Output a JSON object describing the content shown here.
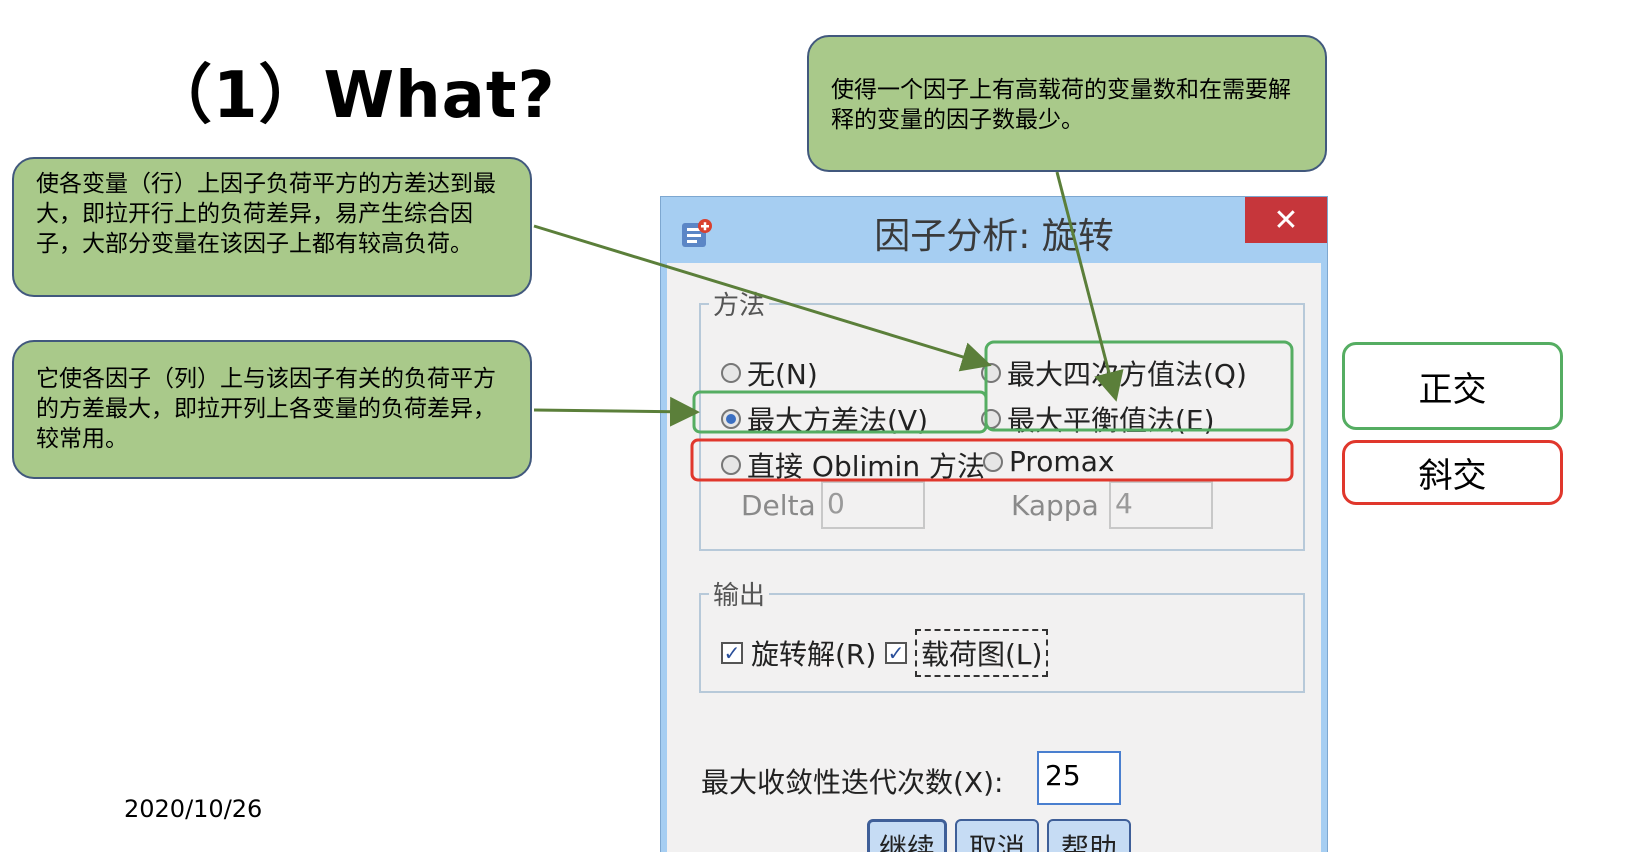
{
  "slide": {
    "title": "（1）What?",
    "date": "2020/10/26"
  },
  "callouts": {
    "variance_rows": "使各变量（行）上因子负荷平方的方差达到最大，即拉开行上的负荷差异，易产生综合因子，大部分变量在该因子上都有较高负荷。",
    "varimax": "它使各因子（列）上与该因子有关的负荷平方的方差最大，即拉开列上各变量的负荷差异，较常用。",
    "quartimax": "使得一个因子上有高载荷的变量数和在需要解释的变量的因子数最少。"
  },
  "labels": {
    "orthogonal": "正交",
    "oblique": "斜交"
  },
  "dialog": {
    "title": "因子分析: 旋转",
    "close_glyph": "✕",
    "method_group": {
      "legend": "方法",
      "options": {
        "none": "无(N)",
        "quartimax": "最大四次方值法(Q)",
        "varimax": "最大方差法(V)",
        "equamax": "最大平衡值法(E)",
        "oblimin": "直接 Oblimin 方法",
        "promax": "Promax"
      },
      "selected": "varimax",
      "delta_label": "Delta",
      "delta_value": "0",
      "kappa_label": "Kappa",
      "kappa_value": "4"
    },
    "output_group": {
      "legend": "输出",
      "rotated_solution": "旋转解(R)",
      "loading_plot": "载荷图(L)",
      "rotated_checked": true,
      "loading_checked": true
    },
    "max_iterations_label": "最大收敛性迭代次数(X):",
    "max_iterations_value": "25",
    "buttons": {
      "continue": "继续",
      "cancel": "取消",
      "help": "帮助"
    }
  },
  "colors": {
    "callout_fill": "#a9c98a",
    "callout_border": "#41587d",
    "orthogonal_frame": "#55ad62",
    "oblique_frame": "#e0372c",
    "arrow": "#5b7f3a",
    "close_button": "#c6363b"
  },
  "icons": {
    "app": "spss-dialog-icon",
    "close": "close-icon",
    "check": "check-mark-icon"
  }
}
